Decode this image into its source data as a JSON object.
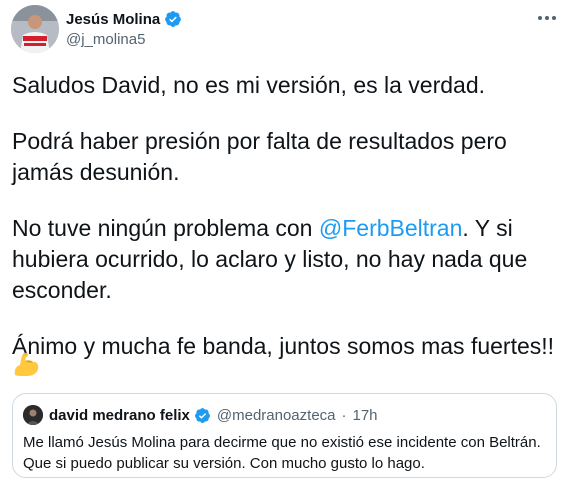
{
  "tweet": {
    "author_name": "Jesús Molina",
    "author_handle": "@j_molina5",
    "paragraph1": "Saludos David, no es mi versión, es la verdad.",
    "paragraph2": "Podrá haber presión por falta de resultados pero jamás desunión.",
    "paragraph3_pre": "No tuve ningún problema con ",
    "paragraph3_mention": "@FerbBeltran",
    "paragraph3_post": ". Y si hubiera ocurrido, lo aclaro y listo, no hay nada que esconder.",
    "paragraph4": "Ánimo y mucha fe banda, juntos somos mas fuertes!!",
    "emoji": "flexed-biceps-emoji"
  },
  "quote": {
    "author_name": "david medrano felix",
    "author_handle": "@medranoazteca",
    "separator": "·",
    "time": "17h",
    "text": "Me llamó Jesús Molina para decirme que no existió ese incidente con Beltrán. Que si puedo publicar su versión. Con mucho gusto lo hago."
  },
  "icons": {
    "verified": "verified-badge-icon",
    "more": "more-options-icon"
  },
  "colors": {
    "verified_blue": "#1d9bf0",
    "mention_blue": "#1d9bf0",
    "secondary_text": "#536471",
    "border": "#cfd9de"
  }
}
